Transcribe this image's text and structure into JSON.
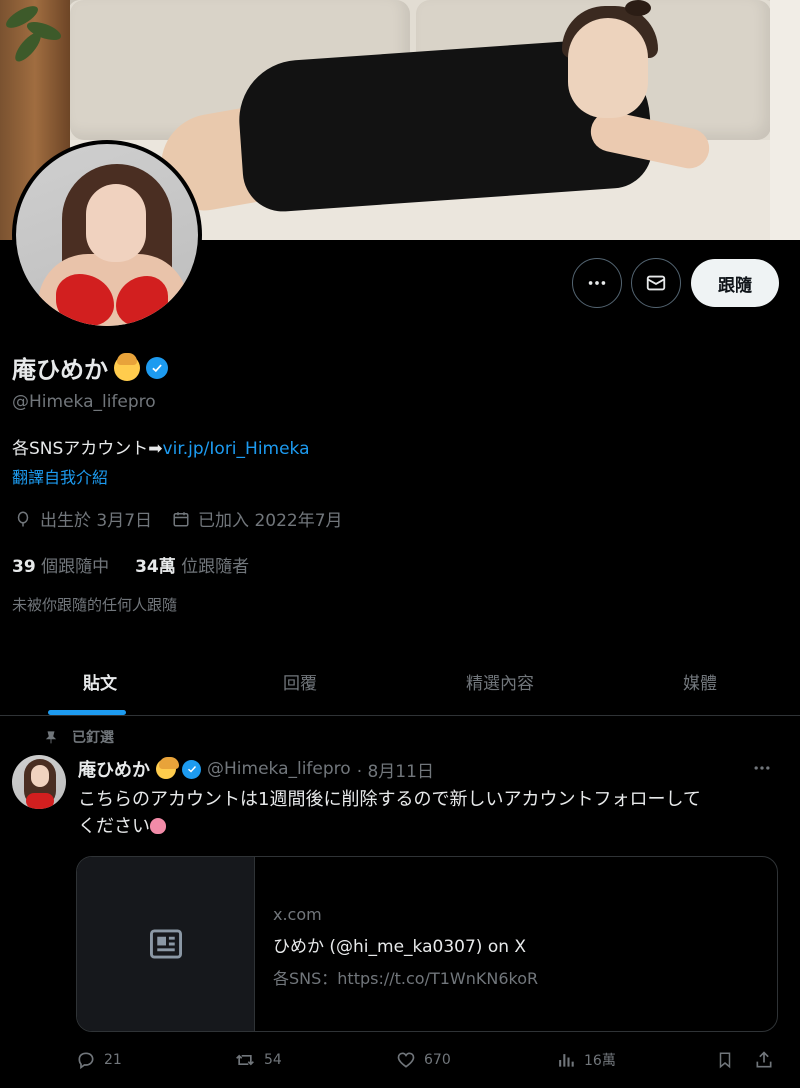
{
  "profile": {
    "name": "庵ひめか",
    "handle": "@Himeka_lifepro",
    "bio_text": "各SNSアカウント➡",
    "bio_link": "vir.jp/Iori_Himeka",
    "translate_label": "翻譯自我介紹",
    "birthday": "出生於 3月7日",
    "joined": "已加入 2022年7月",
    "following_count": "39",
    "following_label": "個跟隨中",
    "followers_count": "34萬",
    "followers_label": "位跟隨者",
    "followed_by_note": "未被你跟隨的任何人跟隨"
  },
  "actions": {
    "follow_label": "跟隨",
    "more_icon": "more-icon",
    "message_icon": "mail-icon"
  },
  "tabs": [
    {
      "label": "貼文",
      "active": true
    },
    {
      "label": "回覆",
      "active": false
    },
    {
      "label": "精選內容",
      "active": false
    },
    {
      "label": "媒體",
      "active": false
    }
  ],
  "post": {
    "pinned_label": "已釘選",
    "author_name": "庵ひめか",
    "author_handle": "@Himeka_lifepro",
    "date": "· 8月11日",
    "text_line1": "こちらのアカウントは1週間後に削除するので新しいアカウントフォローして",
    "text_line2": "ください",
    "card": {
      "domain": "x.com",
      "title": "ひめか (@hi_me_ka0307) on X",
      "description": "各SNS：https://t.co/T1WnKN6koR"
    },
    "stats": {
      "replies": "21",
      "reposts": "54",
      "likes": "670",
      "views": "16萬"
    }
  },
  "colors": {
    "accent": "#1d9bf0",
    "background": "#000000",
    "muted_text": "#71767b"
  }
}
